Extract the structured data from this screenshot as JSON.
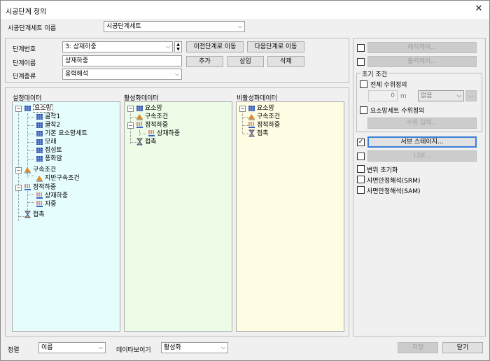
{
  "window": {
    "title": "시공단계 정의"
  },
  "set_name": {
    "label": "시공단계세트 이름",
    "value": "시공단계세트"
  },
  "stage": {
    "number_label": "단계번호",
    "number_value": "3: 상재하중",
    "name_label": "단계이름",
    "name_value": "상재하중",
    "type_label": "단계종류",
    "type_value": "응력해석",
    "prev_label": "이전단계로 이동",
    "next_label": "다음단계로 이동",
    "add_label": "추가",
    "insert_label": "삽입",
    "delete_label": "삭제"
  },
  "panels": {
    "settings": {
      "label": "설정데이터",
      "items": [
        "요소망",
        "굴착1",
        "굴착2",
        "기본 요소망세트",
        "모래",
        "점성토",
        "풍화암",
        "구속조건",
        "지반구속조건",
        "정적하중",
        "상재하중",
        "자중",
        "접촉"
      ]
    },
    "active": {
      "label": "활성화데이터",
      "items": [
        "요소망",
        "구속조건",
        "정적하중",
        "상재하중",
        "접촉"
      ]
    },
    "inactive": {
      "label": "비활성화데이터",
      "items": [
        "요소망",
        "구속조건",
        "정적하중",
        "접촉"
      ]
    }
  },
  "right": {
    "analysis_control": "해석제어...",
    "output_control": "출력제어...",
    "initial_condition": "초기 조건",
    "total_water": "전체 수위정의",
    "water_value": "0",
    "water_unit": "m",
    "none": "없음",
    "ellipsis": "...",
    "mesh_water": "요소망세트 수위정의",
    "water_input": "수위 입력...",
    "sub_stage": "서브 스테이지...",
    "ldf": "LDF...",
    "disp_init": "변위 초기화",
    "srm": "사면안정해석(SRM)",
    "sam": "사면안정해석(SAM)"
  },
  "bottom": {
    "sort_label": "정렬",
    "sort_value": "이름",
    "view_label": "데이타보이기",
    "view_value": "활성화",
    "save": "저장",
    "close": "닫기"
  }
}
